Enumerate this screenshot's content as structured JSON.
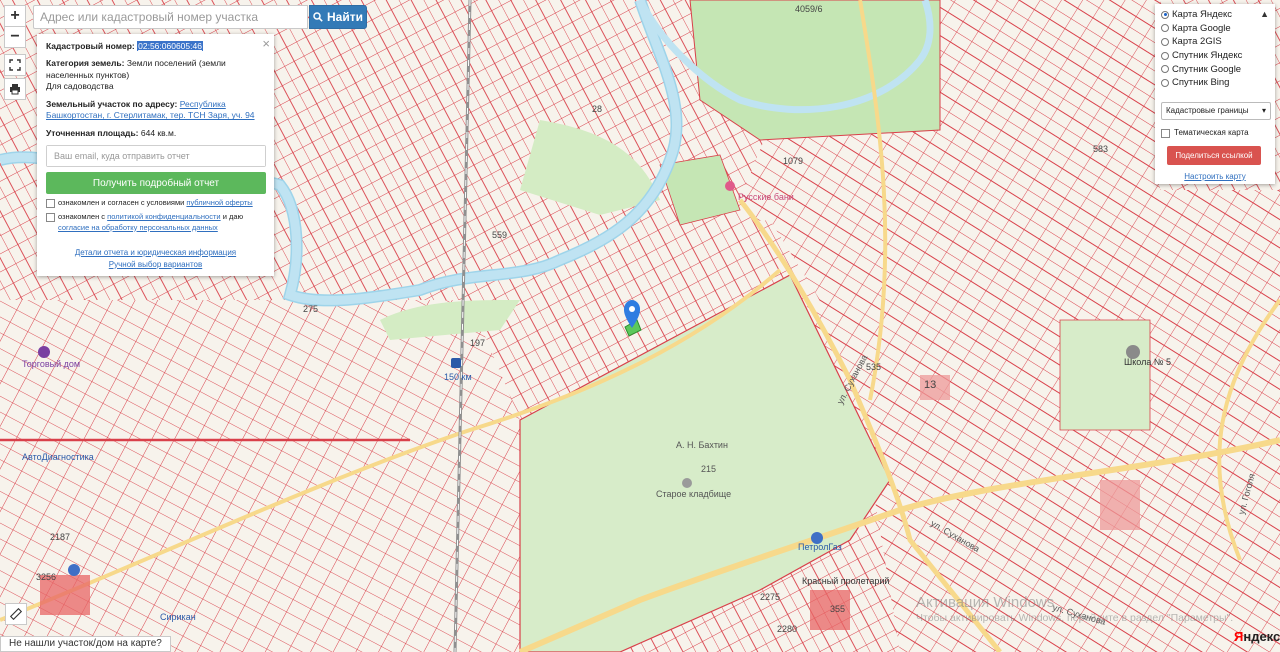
{
  "search": {
    "placeholder": "Адрес или кадастровый номер участка",
    "button_label": "Найти"
  },
  "tools": {
    "zoom_in": "+",
    "zoom_out": "−"
  },
  "info": {
    "kad_label": "Кадастровый номер:",
    "kad_value": "02:56:060605:46",
    "category_label": "Категория земель:",
    "category_value": "Земли поселений (земли населенных пунктов)",
    "usage": "Для садоводства",
    "address_label": "Земельный участок по адресу:",
    "address_value": "Республика Башкортостан, г. Стерлитамак, тер. ТСН Заря, уч. 94",
    "area_label": "Уточненная площадь:",
    "area_value": "644 кв.м.",
    "email_placeholder": "Ваш email, куда отправить отчет",
    "report_button": "Получить подробный отчет",
    "agree1_prefix": "ознакомлен и согласен с условиями",
    "agree1_link": "публичной оферты",
    "agree2_prefix": "ознакомлен с",
    "agree2_link1": "политикой конфиденциальности",
    "agree2_middle": "и даю",
    "agree2_link2": "согласие на обработку персональных данных",
    "details_link": "Детали отчета и юридическая информация",
    "manual_link": "Ручной выбор вариантов"
  },
  "layers": {
    "options": [
      "Карта Яндекс",
      "Карта Google",
      "Карта 2GIS",
      "Спутник Яндекс",
      "Спутник Google",
      "Спутник Bing"
    ],
    "selected_index": 0,
    "overlay_select": "Кадастровые границы",
    "thematic_label": "Тематическая карта",
    "share_button": "Поделиться ссылкой",
    "setup_link": "Настроить карту"
  },
  "bottom": {
    "not_found": "Не нашли участок/дом на карте?",
    "yandex_logo_y": "Я",
    "yandex_logo_rest": "ндекс",
    "activation_title": "Активация Windows",
    "activation_sub": "Чтобы активировать Windows, перейдите в раздел \"Параметры\"."
  },
  "map_labels": {
    "cemetery_person": "А. Н. Бахтин",
    "cemetery_num": "215",
    "cemetery_name": "Старое кладбище",
    "station": "150 км",
    "bani": "Русские бани",
    "school": "Школа № 5",
    "petrol": "ПетролГаз",
    "krasny": "Красный пролетарий",
    "sukhanova1": "ул. Суханова",
    "sukhanova2": "ул. Суханова",
    "sukhanova3": "ул. Суханова",
    "gogolya": "ул. Гоголя",
    "n4059": "4059/6",
    "n1079": "1079",
    "n275": "275",
    "n559": "559",
    "n28": "28",
    "n13": "13",
    "n535": "535",
    "n2187": "2187",
    "n3256": "3256",
    "n2275": "2275",
    "n2280": "2280",
    "n355": "355",
    "n197": "197",
    "n583": "583",
    "trading": "Торговый дом",
    "autodiag": "АвтоДиагностика",
    "siriqn": "Сирикан"
  },
  "colors": {
    "parcel": "#d9404a",
    "green": "#c5e6b4",
    "water": "#bfe3f2",
    "road": "#f7d98b"
  }
}
